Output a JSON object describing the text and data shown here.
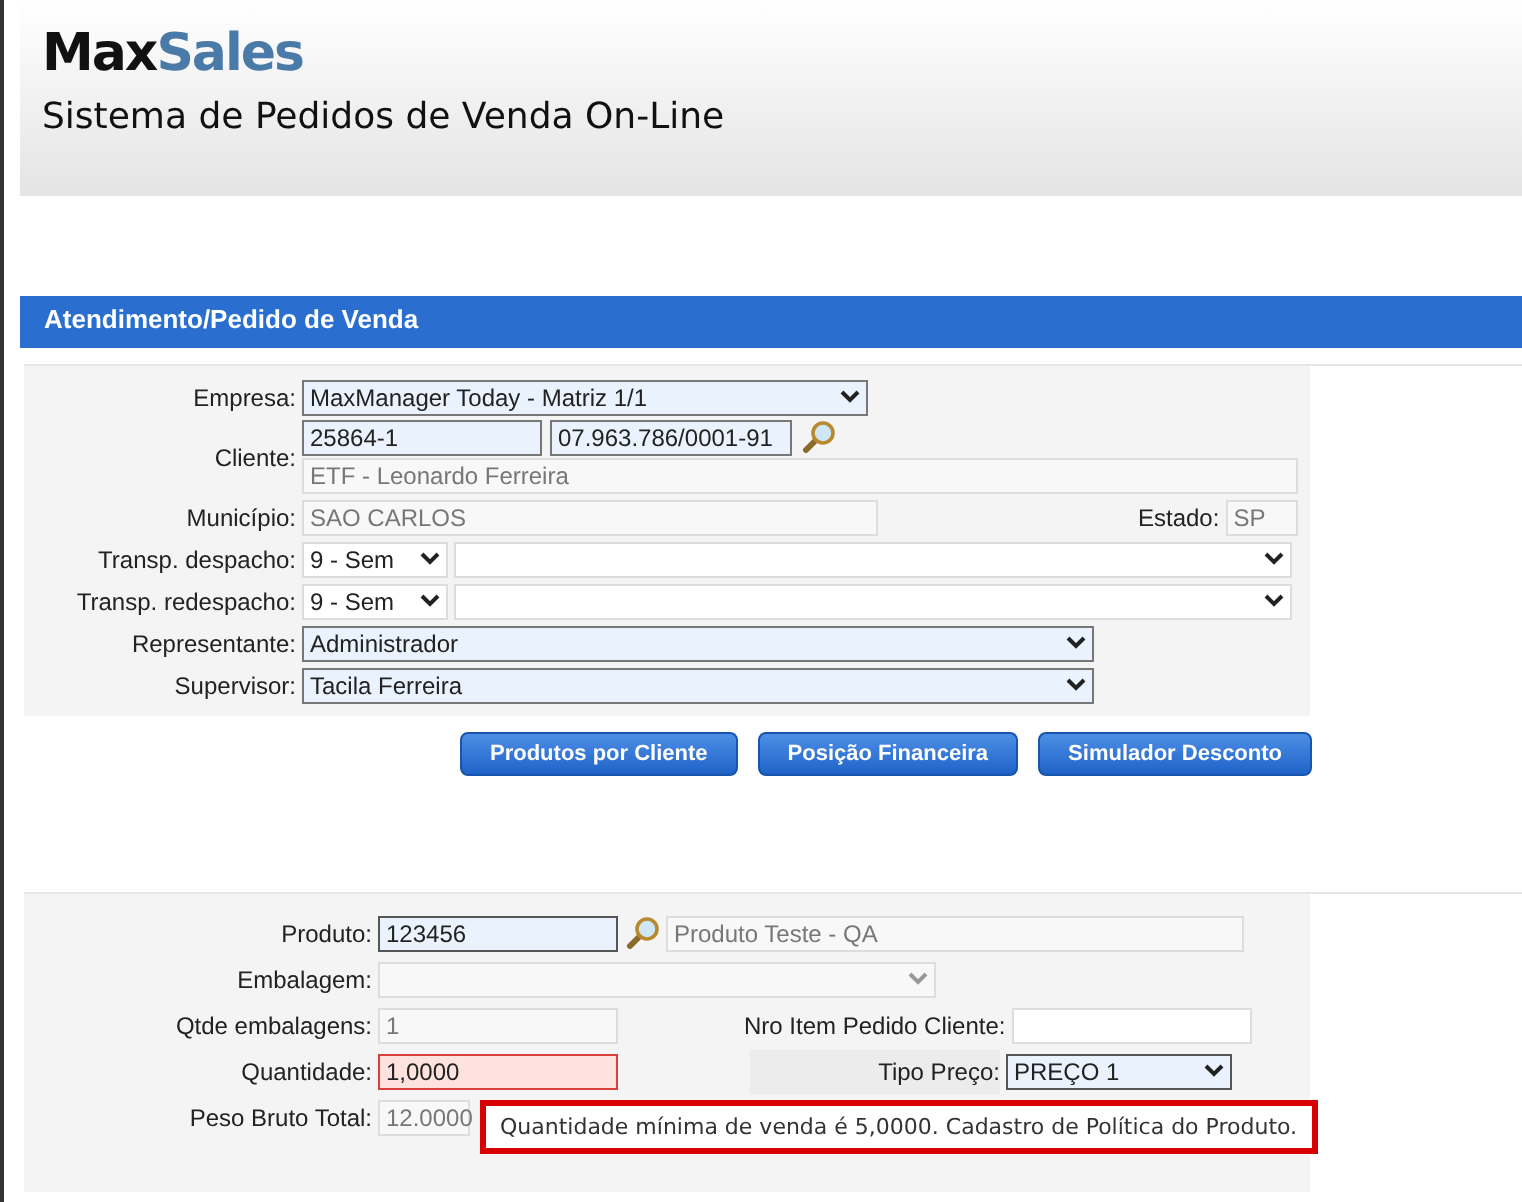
{
  "brand": {
    "name_dark": "Max",
    "name_accent": "Sales",
    "subtitle": "Sistema de Pedidos de Venda On-Line"
  },
  "section_title": "Atendimento/Pedido de Venda",
  "order": {
    "company": {
      "label": "Empresa:",
      "value": "MaxManager Today - Matriz 1/1"
    },
    "client": {
      "label": "Cliente:",
      "code": "25864-1",
      "document": "07.963.786/0001-91",
      "name": "ETF - Leonardo Ferreira"
    },
    "city": {
      "label": "Município:",
      "value": "SAO CARLOS"
    },
    "state": {
      "label": "Estado:",
      "value": "SP"
    },
    "carriers": [
      {
        "label": "Transp. despacho:",
        "code": "9 - Sem"
      },
      {
        "label": "Transp. redespacho:",
        "code": "9 - Sem"
      }
    ],
    "representative": {
      "label": "Representante:",
      "value": "Administrador"
    },
    "supervisor": {
      "label": "Supervisor:",
      "value": "Tacila Ferreira"
    }
  },
  "buttons": [
    "Produtos por Cliente",
    "Posição Financeira",
    "Simulador Desconto"
  ],
  "item": {
    "product": {
      "label": "Produto:",
      "code": "123456",
      "name": "Produto Teste - QA"
    },
    "packaging": {
      "label": "Embalagem:",
      "disabled": true
    },
    "package_qty": {
      "label": "Qtde embalagens:",
      "value": "1",
      "disabled": true,
      "error": false
    },
    "customer_item": {
      "label": "Nro Item Pedido Cliente:"
    },
    "quantity": {
      "label": "Quantidade:",
      "value": "1,0000",
      "error": true
    },
    "price_type": {
      "label": "Tipo Preço:",
      "value": "PREÇO 1"
    },
    "gross_weight": {
      "label": "Peso Bruto Total:",
      "value": "12.0000",
      "disabled": true,
      "error": false
    }
  },
  "error_tooltip": "Quantidade mínima de venda é 5,0000. Cadastro de Política do Produto."
}
